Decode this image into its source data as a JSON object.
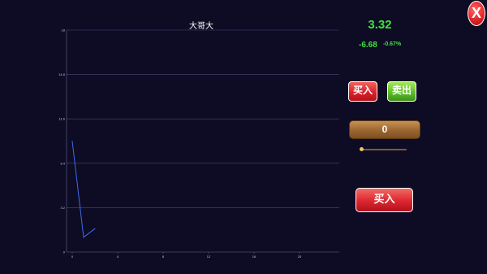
{
  "chart_data": {
    "type": "line",
    "title": "大哥大",
    "x_ticks": [
      "0",
      "4",
      "8",
      "12",
      "16",
      "20"
    ],
    "y_ticks": [
      "0",
      "3.2",
      "6.4",
      "11.6",
      "14.8",
      "18"
    ],
    "xlim": [
      -0.5,
      23.5
    ],
    "ylim": [
      0,
      18
    ],
    "grid": true,
    "series": [
      {
        "x": [
          0,
          1,
          2
        ],
        "values": [
          9.0,
          1.2,
          1.9
        ],
        "color": "#3d6cf0"
      }
    ]
  },
  "stock": {
    "price": "3.32",
    "change": "-6.68",
    "change_pct": "-0.67%"
  },
  "buttons": {
    "buy_small": "买入",
    "sell_small": "卖出",
    "buy_big": "买入",
    "close": "X"
  },
  "quantity": {
    "value": "0",
    "slider_fraction": 0
  },
  "colors": {
    "background": "#0e0b24",
    "gain_loss_text": "#3ee23e",
    "buy": "#dc2630",
    "sell": "#5fbe2a",
    "line": "#3d6cf0"
  }
}
